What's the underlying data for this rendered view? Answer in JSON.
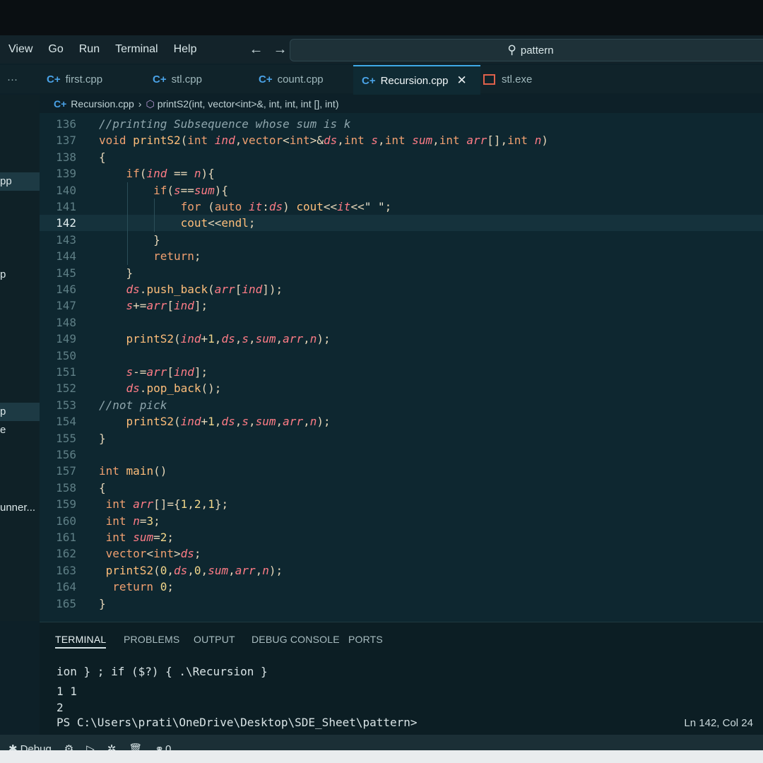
{
  "menu": {
    "items": [
      "View",
      "Go",
      "Run",
      "Terminal",
      "Help"
    ]
  },
  "search": {
    "text": "pattern"
  },
  "tabs": [
    {
      "label": "first.cpp"
    },
    {
      "label": "stl.cpp"
    },
    {
      "label": "count.cpp"
    },
    {
      "label": "Recursion.cpp",
      "active": true
    },
    {
      "label": "stl.exe"
    }
  ],
  "breadcrumb": {
    "file": "Recursion.cpp",
    "symbol": "printS2(int, vector<int>&, int, int, int [], int)"
  },
  "sidebar": {
    "items": [
      "pp",
      "p",
      "p",
      "e",
      "unner..."
    ]
  },
  "editor": {
    "current_line": 142,
    "lines": [
      {
        "n": 136,
        "code": "//printing Subsequence whose sum is k"
      },
      {
        "n": 137,
        "code": "void printS2(int ind,vector<int>&ds,int s,int sum,int arr[],int n)"
      },
      {
        "n": 138,
        "code": "{"
      },
      {
        "n": 139,
        "code": "    if(ind == n){"
      },
      {
        "n": 140,
        "code": "        if(s==sum){"
      },
      {
        "n": 141,
        "code": "            for (auto it:ds) cout<<it<<\" \";"
      },
      {
        "n": 142,
        "code": "            cout<<endl;"
      },
      {
        "n": 143,
        "code": "        }"
      },
      {
        "n": 144,
        "code": "        return;"
      },
      {
        "n": 145,
        "code": "    }"
      },
      {
        "n": 146,
        "code": "    ds.push_back(arr[ind]);"
      },
      {
        "n": 147,
        "code": "    s+=arr[ind];"
      },
      {
        "n": 148,
        "code": ""
      },
      {
        "n": 149,
        "code": "    printS2(ind+1,ds,s,sum,arr,n);"
      },
      {
        "n": 150,
        "code": ""
      },
      {
        "n": 151,
        "code": "    s-=arr[ind];"
      },
      {
        "n": 152,
        "code": "    ds.pop_back();"
      },
      {
        "n": 153,
        "code": "//not pick"
      },
      {
        "n": 154,
        "code": "    printS2(ind+1,ds,s,sum,arr,n);"
      },
      {
        "n": 155,
        "code": "}"
      },
      {
        "n": 156,
        "code": ""
      },
      {
        "n": 157,
        "code": "int main()"
      },
      {
        "n": 158,
        "code": "{"
      },
      {
        "n": 159,
        "code": " int arr[]={1,2,1};"
      },
      {
        "n": 160,
        "code": " int n=3;"
      },
      {
        "n": 161,
        "code": " int sum=2;"
      },
      {
        "n": 162,
        "code": " vector<int>ds;"
      },
      {
        "n": 163,
        "code": " printS2(0,ds,0,sum,arr,n);"
      },
      {
        "n": 164,
        "code": "  return 0;"
      },
      {
        "n": 165,
        "code": "}"
      }
    ]
  },
  "panel": {
    "tabs": [
      "TERMINAL",
      "PROBLEMS",
      "OUTPUT",
      "DEBUG CONSOLE",
      "PORTS"
    ],
    "active_tab": "TERMINAL",
    "terminal_lines": [
      "ion } ; if ($?) { .\\Recursion }",
      "1 1",
      "2",
      "PS C:\\Users\\prati\\OneDrive\\Desktop\\SDE_Sheet\\pattern>"
    ]
  },
  "status": {
    "debug_label": "Debug",
    "ports_count": "0",
    "cursor": "Ln 142, Col 24"
  },
  "colors": {
    "editor_bg": "#0e2730",
    "accent": "#3fa9e6",
    "keyword": "#f0a070",
    "function": "#ffbe7a",
    "parameter": "#ff7c86",
    "comment": "#8fa6ad"
  }
}
